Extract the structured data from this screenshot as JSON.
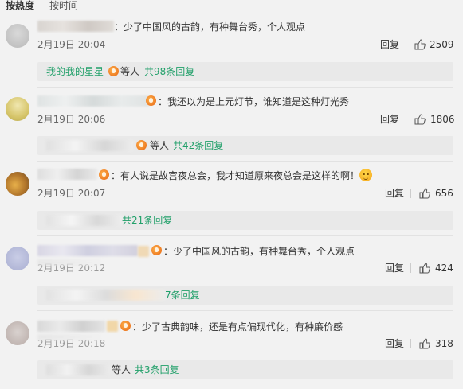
{
  "sort_tabs": [
    {
      "label": "按热度",
      "active": true
    },
    {
      "label": "按时间",
      "active": false
    }
  ],
  "reply_label": "回复",
  "comments": [
    {
      "text": "：少了中国风的古韵，有种舞台秀，个人观点",
      "time": "2月19日 20:04",
      "likes": "2509",
      "sub_user": "我的我的星星",
      "sub_etc": "等人",
      "sub_count": "共98条回复"
    },
    {
      "text": "：我还以为是上元灯节，谁知道是这种灯光秀",
      "time": "2月19日 20:06",
      "likes": "1806",
      "sub_etc": "等人",
      "sub_count": "共42条回复"
    },
    {
      "text": "：有人说是故宫夜总会，我才知道原来夜总会是这样的啊！",
      "time": "2月19日 20:07",
      "likes": "656",
      "sub_count": "共21条回复"
    },
    {
      "text": "：少了中国风的古韵，有种舞台秀，个人观点",
      "time": "2月19日 20:12",
      "likes": "424",
      "sub_count": "7条回复"
    },
    {
      "text": "：少了古典韵味，还是有点偏现代化，有种廉价感",
      "time": "2月19日 20:18",
      "likes": "318",
      "sub_etc": "等人",
      "sub_count": "共3条回复"
    }
  ],
  "colors": {
    "background": "#f2f2f2",
    "link_green": "#22a06a",
    "reply_box": "#e9e9e9",
    "badge_orange": "#e6630f"
  }
}
